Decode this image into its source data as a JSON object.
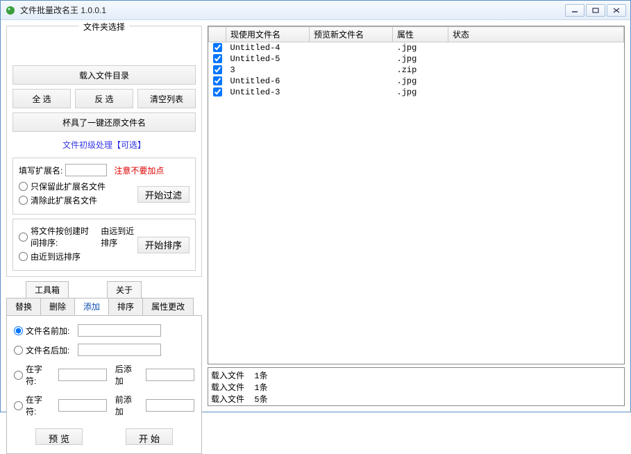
{
  "window": {
    "title": "文件批量改名王  1.0.0.1"
  },
  "folder_group": {
    "legend": "文件夹选择",
    "load_dir": "载入文件目录",
    "select_all": "全 选",
    "invert": "反 选",
    "clear": "清空列表",
    "restore": "杯具了一键还原文件名"
  },
  "primary": {
    "header": "文件初级处理",
    "header_suffix": "【可选】",
    "ext_label": "填写扩展名:",
    "ext_warn": "注意不要加点",
    "keep_ext": "只保留此扩展名文件",
    "remove_ext": "清除此扩展名文件",
    "filter_btn": "开始过滤",
    "sort_by_ctime": "将文件按创建时间排序:",
    "sort_far_near": "由远到近排序",
    "sort_near_far": "由近到远排序",
    "sort_btn": "开始排序"
  },
  "tabs": {
    "toolbox": "工具箱",
    "about": "关于",
    "replace": "替换",
    "delete": "删除",
    "add": "添加",
    "sort": "排序",
    "attr": "属性更改"
  },
  "add_panel": {
    "prefix": "文件名前加:",
    "suffix": "文件名后加:",
    "at_char1": "在字符:",
    "after_add": "后添加",
    "at_char2": "在字符:",
    "before_add": "前添加",
    "preview": "预 览",
    "start": "开 始"
  },
  "table": {
    "headers": [
      "现使用文件名",
      "预览新文件名",
      "属性",
      "状态"
    ],
    "rows": [
      {
        "checked": true,
        "name": "Untitled-4",
        "preview": "",
        "attr": ".jpg",
        "status": ""
      },
      {
        "checked": true,
        "name": "Untitled-5",
        "preview": "",
        "attr": ".jpg",
        "status": ""
      },
      {
        "checked": true,
        "name": "3",
        "preview": "",
        "attr": ".zip",
        "status": ""
      },
      {
        "checked": true,
        "name": "Untitled-6",
        "preview": "",
        "attr": ".jpg",
        "status": ""
      },
      {
        "checked": true,
        "name": "Untitled-3",
        "preview": "",
        "attr": ".jpg",
        "status": ""
      }
    ]
  },
  "log": {
    "lines": [
      "载入文件  1条",
      "载入文件  1条",
      "载入文件  5条"
    ]
  }
}
